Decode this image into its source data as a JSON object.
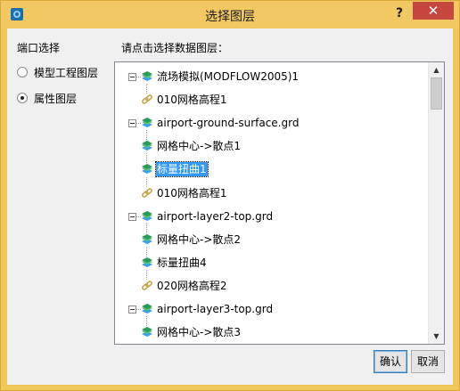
{
  "window": {
    "title": "选择图层",
    "help_label": "?",
    "close_label": "✕"
  },
  "left_panel": {
    "title": "端口选择",
    "options": [
      {
        "label": "模型工程图层",
        "checked": false
      },
      {
        "label": "属性图层",
        "checked": true
      }
    ]
  },
  "tree": {
    "title": "请点击选择数据图层：",
    "items": [
      {
        "label": "流场模拟(MODFLOW2005)1",
        "icon": "layer-stack-icon",
        "expandable": true,
        "selected": false
      },
      {
        "label": "010网格高程1",
        "icon": "link-icon",
        "expandable": false,
        "selected": false
      },
      {
        "label": "airport-ground-surface.grd",
        "icon": "layer-stack-icon",
        "expandable": true,
        "selected": false
      },
      {
        "label": "网格中心->散点1",
        "icon": "layer-stack-icon",
        "expandable": false,
        "selected": false
      },
      {
        "label": "标量扭曲1",
        "icon": "layer-stack-icon",
        "expandable": false,
        "selected": true
      },
      {
        "label": "010网格高程1",
        "icon": "link-icon",
        "expandable": false,
        "selected": false
      },
      {
        "label": "airport-layer2-top.grd",
        "icon": "layer-stack-icon",
        "expandable": true,
        "selected": false
      },
      {
        "label": "网格中心->散点2",
        "icon": "layer-stack-icon",
        "expandable": false,
        "selected": false
      },
      {
        "label": "标量扭曲4",
        "icon": "layer-stack-icon",
        "expandable": false,
        "selected": false
      },
      {
        "label": "020网格高程2",
        "icon": "link-icon",
        "expandable": false,
        "selected": false
      },
      {
        "label": "airport-layer3-top.grd",
        "icon": "layer-stack-icon",
        "expandable": true,
        "selected": false
      },
      {
        "label": "网格中心->散点3",
        "icon": "layer-stack-icon",
        "expandable": false,
        "selected": false
      }
    ]
  },
  "buttons": {
    "ok_label": "确认",
    "cancel_label": "取消"
  },
  "colors": {
    "title_bar": "#f2c862",
    "close_button": "#c7463f",
    "selection": "#3399ff",
    "layer_icon_top": "#2a9a5a",
    "layer_icon_bottom": "#3aa0e8",
    "link_icon": "#c9a24a"
  }
}
